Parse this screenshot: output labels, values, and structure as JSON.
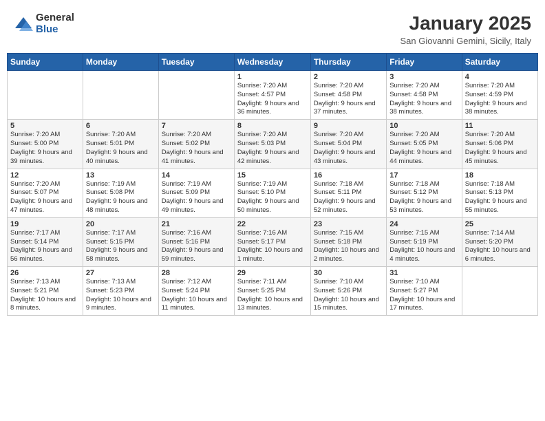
{
  "header": {
    "logo_general": "General",
    "logo_blue": "Blue",
    "month_title": "January 2025",
    "location": "San Giovanni Gemini, Sicily, Italy"
  },
  "days_of_week": [
    "Sunday",
    "Monday",
    "Tuesday",
    "Wednesday",
    "Thursday",
    "Friday",
    "Saturday"
  ],
  "weeks": [
    [
      {
        "day": "",
        "content": ""
      },
      {
        "day": "",
        "content": ""
      },
      {
        "day": "",
        "content": ""
      },
      {
        "day": "1",
        "content": "Sunrise: 7:20 AM\nSunset: 4:57 PM\nDaylight: 9 hours and 36 minutes."
      },
      {
        "day": "2",
        "content": "Sunrise: 7:20 AM\nSunset: 4:58 PM\nDaylight: 9 hours and 37 minutes."
      },
      {
        "day": "3",
        "content": "Sunrise: 7:20 AM\nSunset: 4:58 PM\nDaylight: 9 hours and 38 minutes."
      },
      {
        "day": "4",
        "content": "Sunrise: 7:20 AM\nSunset: 4:59 PM\nDaylight: 9 hours and 38 minutes."
      }
    ],
    [
      {
        "day": "5",
        "content": "Sunrise: 7:20 AM\nSunset: 5:00 PM\nDaylight: 9 hours and 39 minutes."
      },
      {
        "day": "6",
        "content": "Sunrise: 7:20 AM\nSunset: 5:01 PM\nDaylight: 9 hours and 40 minutes."
      },
      {
        "day": "7",
        "content": "Sunrise: 7:20 AM\nSunset: 5:02 PM\nDaylight: 9 hours and 41 minutes."
      },
      {
        "day": "8",
        "content": "Sunrise: 7:20 AM\nSunset: 5:03 PM\nDaylight: 9 hours and 42 minutes."
      },
      {
        "day": "9",
        "content": "Sunrise: 7:20 AM\nSunset: 5:04 PM\nDaylight: 9 hours and 43 minutes."
      },
      {
        "day": "10",
        "content": "Sunrise: 7:20 AM\nSunset: 5:05 PM\nDaylight: 9 hours and 44 minutes."
      },
      {
        "day": "11",
        "content": "Sunrise: 7:20 AM\nSunset: 5:06 PM\nDaylight: 9 hours and 45 minutes."
      }
    ],
    [
      {
        "day": "12",
        "content": "Sunrise: 7:20 AM\nSunset: 5:07 PM\nDaylight: 9 hours and 47 minutes."
      },
      {
        "day": "13",
        "content": "Sunrise: 7:19 AM\nSunset: 5:08 PM\nDaylight: 9 hours and 48 minutes."
      },
      {
        "day": "14",
        "content": "Sunrise: 7:19 AM\nSunset: 5:09 PM\nDaylight: 9 hours and 49 minutes."
      },
      {
        "day": "15",
        "content": "Sunrise: 7:19 AM\nSunset: 5:10 PM\nDaylight: 9 hours and 50 minutes."
      },
      {
        "day": "16",
        "content": "Sunrise: 7:18 AM\nSunset: 5:11 PM\nDaylight: 9 hours and 52 minutes."
      },
      {
        "day": "17",
        "content": "Sunrise: 7:18 AM\nSunset: 5:12 PM\nDaylight: 9 hours and 53 minutes."
      },
      {
        "day": "18",
        "content": "Sunrise: 7:18 AM\nSunset: 5:13 PM\nDaylight: 9 hours and 55 minutes."
      }
    ],
    [
      {
        "day": "19",
        "content": "Sunrise: 7:17 AM\nSunset: 5:14 PM\nDaylight: 9 hours and 56 minutes."
      },
      {
        "day": "20",
        "content": "Sunrise: 7:17 AM\nSunset: 5:15 PM\nDaylight: 9 hours and 58 minutes."
      },
      {
        "day": "21",
        "content": "Sunrise: 7:16 AM\nSunset: 5:16 PM\nDaylight: 9 hours and 59 minutes."
      },
      {
        "day": "22",
        "content": "Sunrise: 7:16 AM\nSunset: 5:17 PM\nDaylight: 10 hours and 1 minute."
      },
      {
        "day": "23",
        "content": "Sunrise: 7:15 AM\nSunset: 5:18 PM\nDaylight: 10 hours and 2 minutes."
      },
      {
        "day": "24",
        "content": "Sunrise: 7:15 AM\nSunset: 5:19 PM\nDaylight: 10 hours and 4 minutes."
      },
      {
        "day": "25",
        "content": "Sunrise: 7:14 AM\nSunset: 5:20 PM\nDaylight: 10 hours and 6 minutes."
      }
    ],
    [
      {
        "day": "26",
        "content": "Sunrise: 7:13 AM\nSunset: 5:21 PM\nDaylight: 10 hours and 8 minutes."
      },
      {
        "day": "27",
        "content": "Sunrise: 7:13 AM\nSunset: 5:23 PM\nDaylight: 10 hours and 9 minutes."
      },
      {
        "day": "28",
        "content": "Sunrise: 7:12 AM\nSunset: 5:24 PM\nDaylight: 10 hours and 11 minutes."
      },
      {
        "day": "29",
        "content": "Sunrise: 7:11 AM\nSunset: 5:25 PM\nDaylight: 10 hours and 13 minutes."
      },
      {
        "day": "30",
        "content": "Sunrise: 7:10 AM\nSunset: 5:26 PM\nDaylight: 10 hours and 15 minutes."
      },
      {
        "day": "31",
        "content": "Sunrise: 7:10 AM\nSunset: 5:27 PM\nDaylight: 10 hours and 17 minutes."
      },
      {
        "day": "",
        "content": ""
      }
    ]
  ]
}
